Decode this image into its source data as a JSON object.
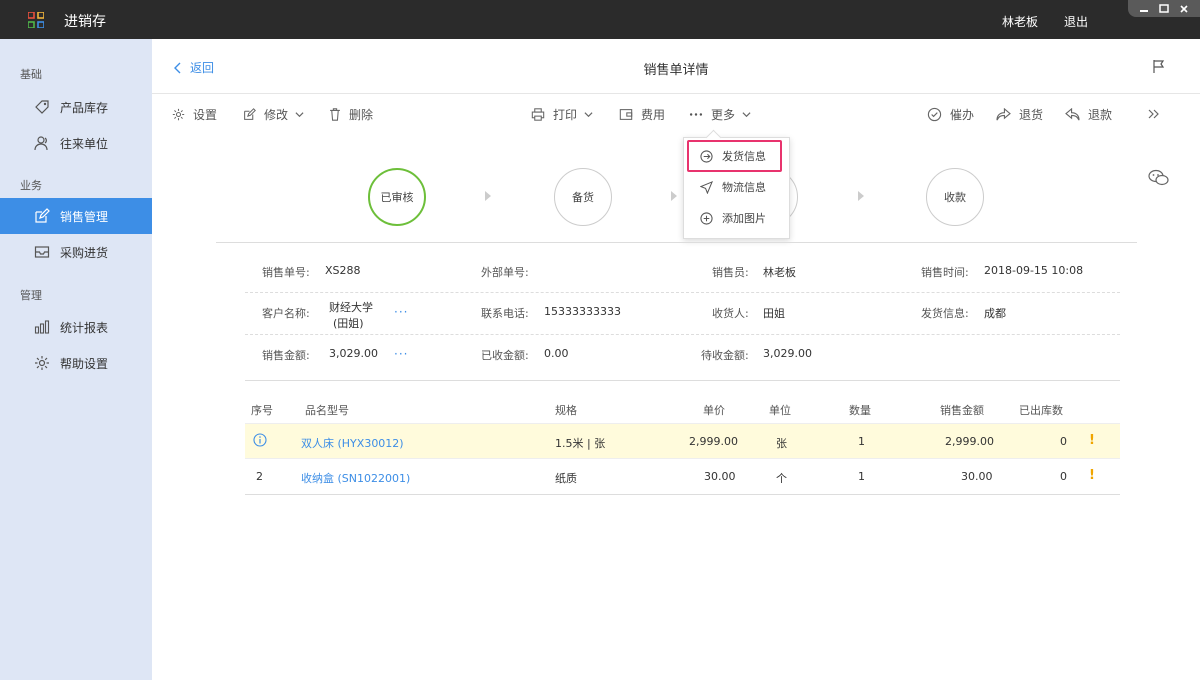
{
  "app": {
    "title": "进销存",
    "user": "林老板",
    "logout": "退出"
  },
  "sidebar": {
    "sections": [
      "基础",
      "业务",
      "管理"
    ],
    "items": [
      {
        "label": "产品库存",
        "icon": "tag-icon"
      },
      {
        "label": "往来单位",
        "icon": "contacts-icon"
      },
      {
        "label": "销售管理",
        "icon": "edit-icon",
        "active": true
      },
      {
        "label": "采购进货",
        "icon": "inbox-icon"
      },
      {
        "label": "统计报表",
        "icon": "bar-chart-icon"
      },
      {
        "label": "帮助设置",
        "icon": "gear-icon"
      }
    ]
  },
  "header": {
    "back": "返回",
    "title": "销售单详情"
  },
  "toolbar": {
    "settings": "设置",
    "edit": "修改",
    "delete": "删除",
    "print": "打印",
    "fee": "费用",
    "more": "更多",
    "urge": "催办",
    "return_goods": "退货",
    "refund": "退款"
  },
  "more_menu": [
    {
      "label": "发货信息",
      "icon": "arrow-circle-icon",
      "highlighted": true
    },
    {
      "label": "物流信息",
      "icon": "send-icon"
    },
    {
      "label": "添加图片",
      "icon": "plus-circle-icon"
    }
  ],
  "stages": [
    {
      "label": "已审核",
      "status": "done"
    },
    {
      "label": "备货",
      "status": "pending"
    },
    {
      "label": "",
      "status": "pending"
    },
    {
      "label": "收款",
      "status": "pending"
    }
  ],
  "info": {
    "order_no_label": "销售单号:",
    "order_no": "XS288",
    "ext_no_label": "外部单号:",
    "ext_no": "",
    "seller_label": "销售员:",
    "seller": "林老板",
    "time_label": "销售时间:",
    "time": "2018-09-15 10:08",
    "customer_label": "客户名称:",
    "customer_line1": "财经大学",
    "customer_line2": "(田姐)",
    "phone_label": "联系电话:",
    "phone": "15333333333",
    "receiver_label": "收货人:",
    "receiver": "田姐",
    "ship_label": "发货信息:",
    "ship": "成都",
    "amount_label": "销售金额:",
    "amount": "3,029.00",
    "received_label": "已收金额:",
    "received": "0.00",
    "pending_label": "待收金额:",
    "pending": "3,029.00",
    "more": "···"
  },
  "table": {
    "headers": [
      "序号",
      "品名型号",
      "规格",
      "单价",
      "单位",
      "数量",
      "销售金额",
      "已出库数"
    ],
    "rows": [
      {
        "no": "",
        "name": "双人床 (HYX30012)",
        "spec": "1.5米 | 张",
        "price": "2,999.00",
        "unit": "张",
        "qty": "1",
        "amount": "2,999.00",
        "out": "0",
        "flag": "!"
      },
      {
        "no": "2",
        "name": "收纳盒 (SN1022001)",
        "spec": "纸质",
        "price": "30.00",
        "unit": "个",
        "qty": "1",
        "amount": "30.00",
        "out": "0",
        "flag": "!"
      }
    ]
  },
  "colors": {
    "accent": "#3d8ee6",
    "done": "#6dbf3a",
    "highlight": "#e8336d",
    "warning": "#f0a500"
  }
}
